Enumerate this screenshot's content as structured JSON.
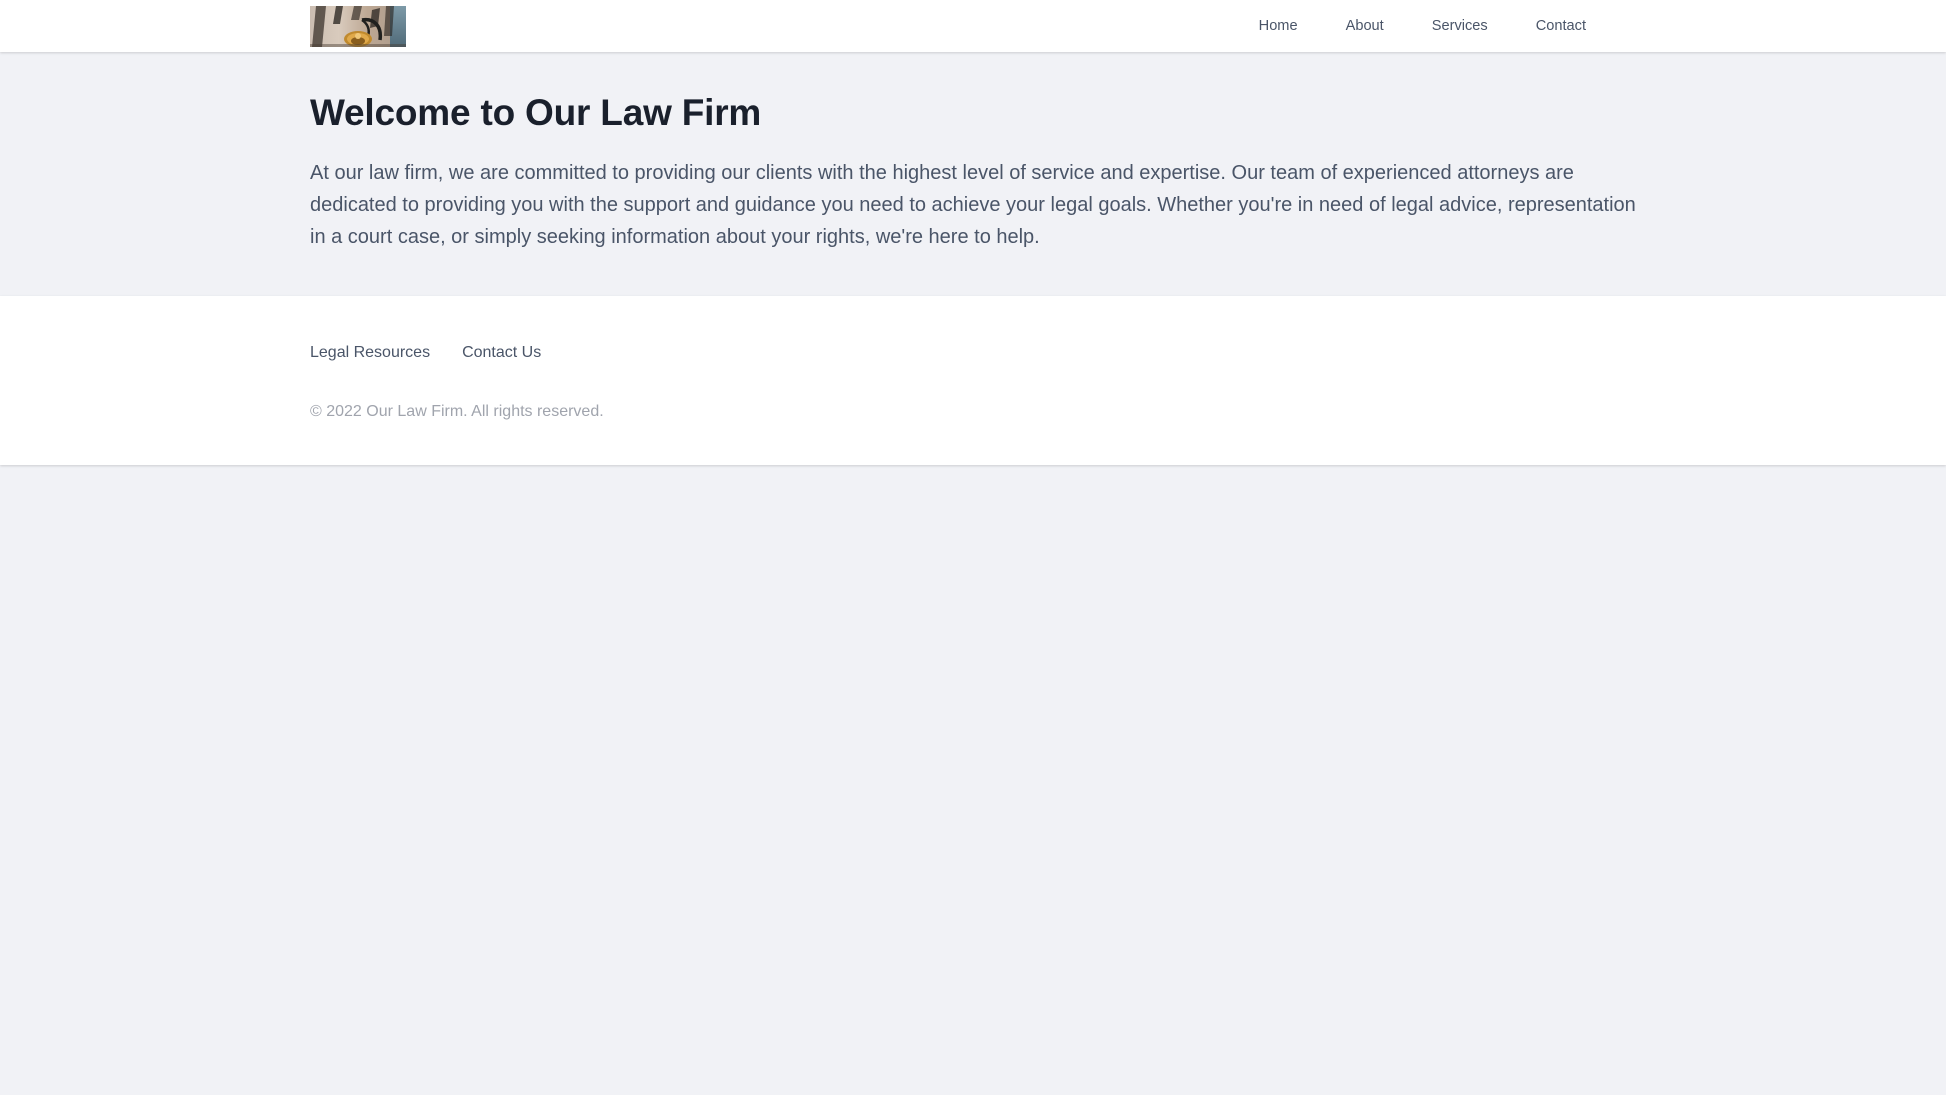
{
  "theme": {
    "page_background": "#f1f2f6",
    "surface": "#ffffff",
    "heading_color": "#1a202c",
    "body_text_color": "#4a5568",
    "muted_text_color": "#a0a4ad"
  },
  "header": {
    "logo": {
      "alt": "Law Firm Logo",
      "description": "photograph of a building facade with an ornate wrought-iron sign bracket"
    },
    "nav": [
      {
        "label": "Home",
        "name": "nav-link-home"
      },
      {
        "label": "About",
        "name": "nav-link-about"
      },
      {
        "label": "Services",
        "name": "nav-link-services"
      },
      {
        "label": "Contact",
        "name": "nav-link-contact"
      }
    ]
  },
  "main": {
    "title": "Welcome to Our Law Firm",
    "paragraph": "At our law firm, we are committed to providing our clients with the highest level of service and expertise. Our team of experienced attorneys are dedicated to providing you with the support and guidance you need to achieve your legal goals. Whether you're in need of legal advice, representation in a court case, or simply seeking information about your rights, we're here to help."
  },
  "footer": {
    "links": [
      {
        "label": "Legal Resources",
        "name": "footer-link-legal-resources"
      },
      {
        "label": "Contact Us",
        "name": "footer-link-contact-us"
      }
    ],
    "copyright": "© 2022 Our Law Firm. All rights reserved."
  }
}
